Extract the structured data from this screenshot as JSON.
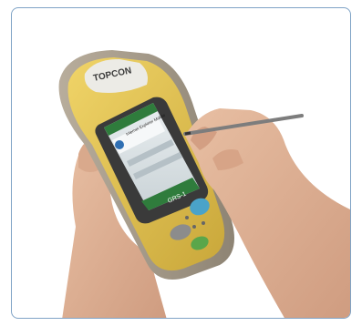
{
  "photo": {
    "brand_logo": "TOPCON",
    "device_model": "GRS-1",
    "screen_title": "Internet Explorer Mobile",
    "frame_color": "#7fa3c6",
    "device_color": "#e3c24e",
    "bumper_color": "#a59a88",
    "screen_color": "#2f7c3c"
  }
}
